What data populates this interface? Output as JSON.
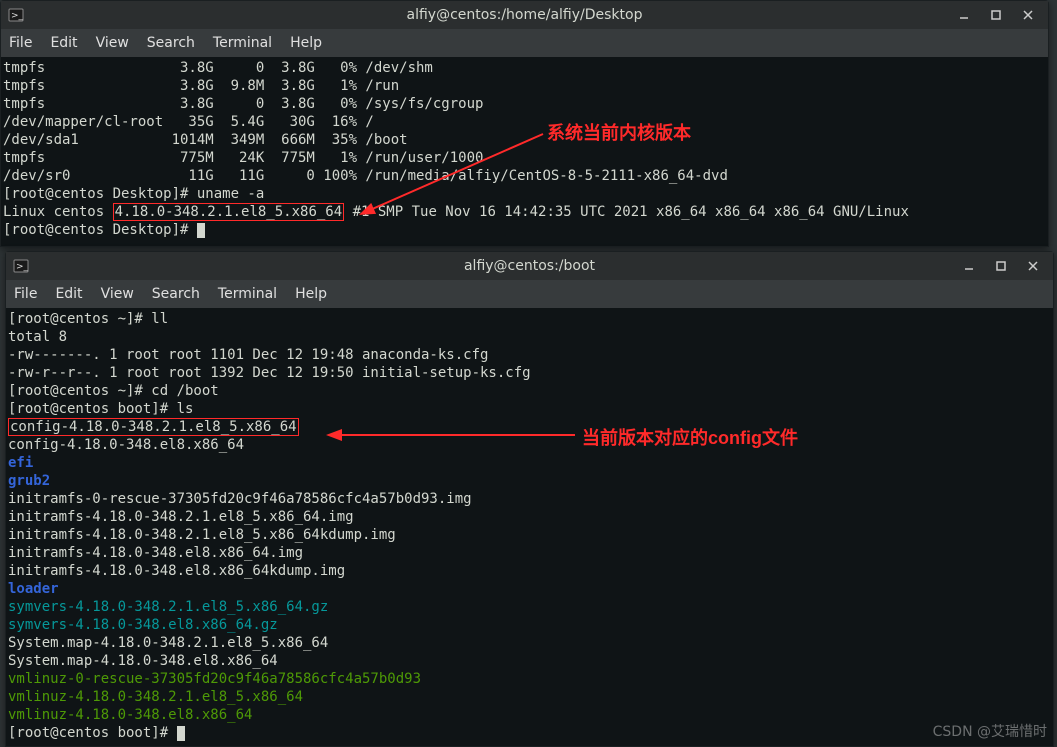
{
  "win1": {
    "title": "alfiy@centos:/home/alfiy/Desktop",
    "menu": {
      "file": "File",
      "edit": "Edit",
      "view": "View",
      "search": "Search",
      "terminal": "Terminal",
      "help": "Help"
    },
    "lines": [
      "tmpfs                3.8G     0  3.8G   0% /dev/shm",
      "tmpfs                3.8G  9.8M  3.8G   1% /run",
      "tmpfs                3.8G     0  3.8G   0% /sys/fs/cgroup",
      "/dev/mapper/cl-root   35G  5.4G   30G  16% /",
      "/dev/sda1           1014M  349M  666M  35% /boot",
      "tmpfs                775M   24K  775M   1% /run/user/1000",
      "/dev/sr0              11G   11G     0 100% /run/media/alfiy/CentOS-8-5-2111-x86_64-dvd",
      "[root@centos Desktop]# uname -a"
    ],
    "kernel_line_pre": "Linux centos ",
    "kernel_boxed": "4.18.0-348.2.1.el8_5.x86_64",
    "kernel_line_post": " #1 SMP Tue Nov 16 14:42:35 UTC 2021 x86_64 x86_64 x86_64 GNU/Linux",
    "prompt_after": "[root@centos Desktop]# "
  },
  "win2": {
    "title": "alfiy@centos:/boot",
    "menu": {
      "file": "File",
      "edit": "Edit",
      "view": "View",
      "search": "Search",
      "terminal": "Terminal",
      "help": "Help"
    },
    "pre_lines": [
      "[root@centos ~]# ll",
      "total 8",
      "-rw-------. 1 root root 1101 Dec 12 19:48 anaconda-ks.cfg",
      "-rw-r--r--. 1 root root 1392 Dec 12 19:50 initial-setup-ks.cfg",
      "[root@centos ~]# cd /boot",
      "[root@centos boot]# ls"
    ],
    "config_boxed": "config-4.18.0-348.2.1.el8_5.x86_64",
    "listing": [
      {
        "t": "config-4.18.0-348.el8.x86_64",
        "c": ""
      },
      {
        "t": "efi",
        "c": "blue"
      },
      {
        "t": "grub2",
        "c": "blue"
      },
      {
        "t": "initramfs-0-rescue-37305fd20c9f46a78586cfc4a57b0d93.img",
        "c": ""
      },
      {
        "t": "initramfs-4.18.0-348.2.1.el8_5.x86_64.img",
        "c": ""
      },
      {
        "t": "initramfs-4.18.0-348.2.1.el8_5.x86_64kdump.img",
        "c": ""
      },
      {
        "t": "initramfs-4.18.0-348.el8.x86_64.img",
        "c": ""
      },
      {
        "t": "initramfs-4.18.0-348.el8.x86_64kdump.img",
        "c": ""
      },
      {
        "t": "loader",
        "c": "blue"
      },
      {
        "t": "symvers-4.18.0-348.2.1.el8_5.x86_64.gz",
        "c": "cyan"
      },
      {
        "t": "symvers-4.18.0-348.el8.x86_64.gz",
        "c": "cyan"
      },
      {
        "t": "System.map-4.18.0-348.2.1.el8_5.x86_64",
        "c": ""
      },
      {
        "t": "System.map-4.18.0-348.el8.x86_64",
        "c": ""
      },
      {
        "t": "vmlinuz-0-rescue-37305fd20c9f46a78586cfc4a57b0d93",
        "c": "green"
      },
      {
        "t": "vmlinuz-4.18.0-348.2.1.el8_5.x86_64",
        "c": "green"
      },
      {
        "t": "vmlinuz-4.18.0-348.el8.x86_64",
        "c": "green"
      }
    ],
    "prompt_after": "[root@centos boot]# "
  },
  "annotations": {
    "kernel_label": "系统当前内核版本",
    "config_label": "当前版本对应的config文件"
  },
  "watermark": "CSDN @艾瑞惜时"
}
